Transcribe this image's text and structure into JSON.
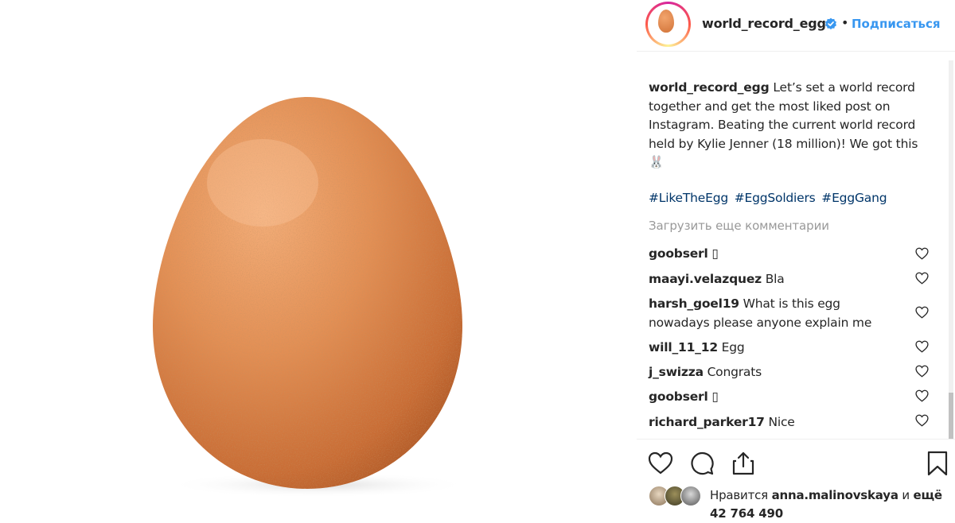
{
  "post": {
    "author": "world_record_egg",
    "follow_label": "Подписаться",
    "dot": "•",
    "caption": "Let’s set a world record together and get the most liked post on Instagram. Beating the current world record held by Kylie Jenner (18 million)! We got this 🐰",
    "hashtags": [
      "#LikeTheEgg",
      "#EggSoldiers",
      "#EggGang"
    ],
    "load_more": "Загрузить еще комментарии"
  },
  "comments": [
    {
      "user": "goobserl",
      "text": "▯"
    },
    {
      "user": "maayi.velazquez",
      "text": "Bla"
    },
    {
      "user": "harsh_goel19",
      "text": "What is this egg nowadays please anyone explain me"
    },
    {
      "user": "will_11_12",
      "text": "Egg"
    },
    {
      "user": "j_swizza",
      "text": "Congrats"
    },
    {
      "user": "goobserl",
      "text": "▯"
    },
    {
      "user": "richard_parker17",
      "text": "Nice"
    }
  ],
  "likes": {
    "prefix": "Нравится",
    "user": "anna.malinovskaya",
    "connector": "и",
    "rest": "ещё 42 764 490"
  },
  "colors": {
    "accent": "#3897f0",
    "hashtag": "#003569",
    "muted": "#999999",
    "egg": "#e08a4f"
  },
  "icons": [
    "verified-badge-icon",
    "heart-icon",
    "comment-icon",
    "share-icon",
    "bookmark-icon"
  ]
}
